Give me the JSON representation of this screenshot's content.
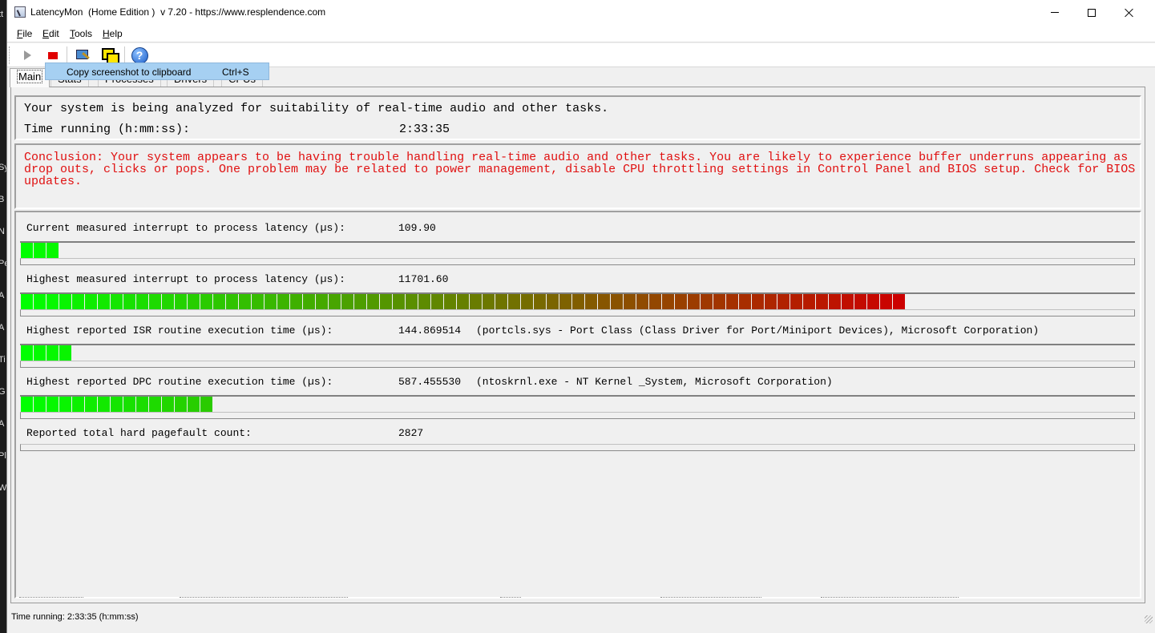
{
  "window": {
    "title": "LatencyMon  (Home Edition )  v 7.20 - https://www.resplendence.com"
  },
  "menu": [
    "File",
    "Edit",
    "Tools",
    "Help"
  ],
  "toolbar": {
    "tooltip_label": "Copy screenshot to clipboard",
    "tooltip_shortcut": "Ctrl+S"
  },
  "tabs": [
    "Main",
    "Stats",
    "Processes",
    "Drivers",
    "CPUs"
  ],
  "main": {
    "status_message": "Your system is being analyzed for suitability of real-time audio and other tasks.",
    "time_label": "Time running (h:mm:ss):",
    "time_value": "2:33:35",
    "conclusion": "Conclusion: Your system appears to be having trouble handling real-time audio and other tasks. You are likely to experience buffer underruns appearing as drop outs, clicks or pops. One problem may be related to power management, disable CPU throttling settings in Control Panel and BIOS setup. Check for BIOS updates."
  },
  "metrics": [
    {
      "label": "Current measured interrupt to process latency (µs):",
      "value": "109.90",
      "detail": "",
      "blocks": 3
    },
    {
      "label": "Highest measured interrupt to process latency (µs):",
      "value": "11701.60",
      "detail": "",
      "blocks": 69
    },
    {
      "label": "Highest reported ISR routine execution time (µs):",
      "value": "144.869514",
      "detail": "(portcls.sys - Port Class (Class Driver for Port/Miniport Devices), Microsoft Corporation)",
      "blocks": 4
    },
    {
      "label": "Highest reported DPC routine execution time (µs):",
      "value": "587.455530",
      "detail": "(ntoskrnl.exe - NT Kernel _System, Microsoft Corporation)",
      "blocks": 15
    },
    {
      "label": "Reported total hard pagefault count:",
      "value": "2827",
      "detail": "",
      "blocks": 0
    }
  ],
  "statusbar": {
    "text": "Time running: 2:33:35  (h:mm:ss)"
  },
  "colors": {
    "conclusion_red": "#e01010",
    "bar_green": "#00ff00",
    "bar_red": "#cc0000"
  },
  "desktop_strip": [
    "tt",
    "Sy",
    "B",
    "N",
    "Pe",
    "A",
    "A",
    "Ti",
    "G",
    "A",
    "Pl",
    "W"
  ]
}
